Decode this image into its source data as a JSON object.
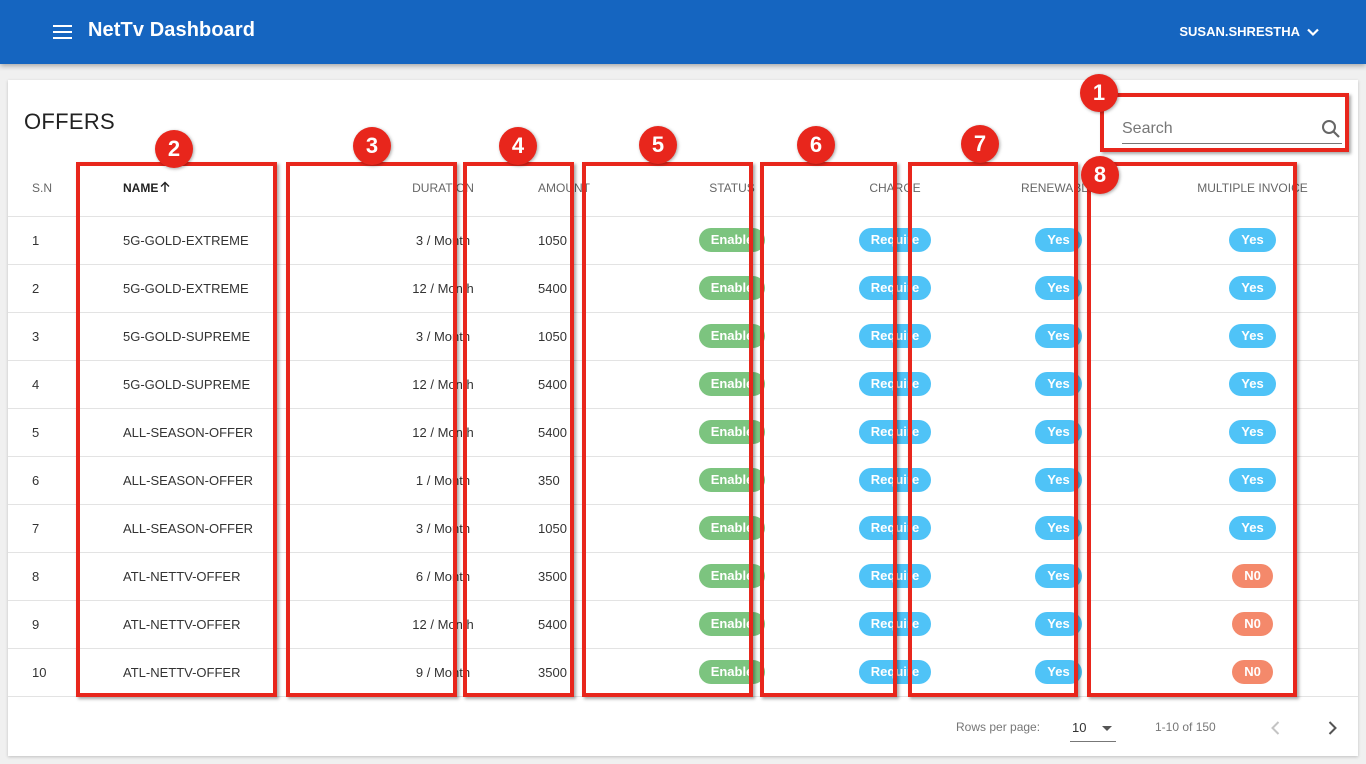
{
  "app": {
    "title": "NetTv Dashboard",
    "user": "SUSAN.SHRESTHA"
  },
  "page": {
    "title": "OFFERS"
  },
  "search": {
    "placeholder": "Search"
  },
  "table": {
    "headers": [
      "S.N",
      "NAME",
      "DURATION",
      "AMOUNT",
      "STATUS",
      "CHARGE",
      "RENEWABLE",
      "MULTIPLE INVOICE"
    ],
    "sort": {
      "column": "NAME",
      "direction": "ascending"
    },
    "rows": [
      [
        "1",
        "5G-GOLD-EXTREME",
        "3 / Month",
        "1050",
        "Enable",
        "Require",
        "Yes",
        "Yes"
      ],
      [
        "2",
        "5G-GOLD-EXTREME",
        "12 / Month",
        "5400",
        "Enable",
        "Require",
        "Yes",
        "Yes"
      ],
      [
        "3",
        "5G-GOLD-SUPREME",
        "3 / Month",
        "1050",
        "Enable",
        "Require",
        "Yes",
        "Yes"
      ],
      [
        "4",
        "5G-GOLD-SUPREME",
        "12 / Month",
        "5400",
        "Enable",
        "Require",
        "Yes",
        "Yes"
      ],
      [
        "5",
        "ALL-SEASON-OFFER",
        "12 / Month",
        "5400",
        "Enable",
        "Require",
        "Yes",
        "Yes"
      ],
      [
        "6",
        "ALL-SEASON-OFFER",
        "1 / Month",
        "350",
        "Enable",
        "Require",
        "Yes",
        "Yes"
      ],
      [
        "7",
        "ALL-SEASON-OFFER",
        "3 / Month",
        "1050",
        "Enable",
        "Require",
        "Yes",
        "Yes"
      ],
      [
        "8",
        "ATL-NETTV-OFFER",
        "6 / Month",
        "3500",
        "Enable",
        "Require",
        "Yes",
        "N0"
      ],
      [
        "9",
        "ATL-NETTV-OFFER",
        "12 / Month",
        "5400",
        "Enable",
        "Require",
        "Yes",
        "N0"
      ],
      [
        "10",
        "ATL-NETTV-OFFER",
        "9 / Month",
        "3500",
        "Enable",
        "Require",
        "Yes",
        "N0"
      ]
    ]
  },
  "pagination": {
    "rows_per_page_label": "Rows per page:",
    "rows_per_page": "10",
    "range": "1-10 of 150"
  },
  "annotations": [
    "1",
    "2",
    "3",
    "4",
    "5",
    "6",
    "7",
    "8"
  ],
  "colors": {
    "appbar": "#1565c0",
    "enable": "#7cc47f",
    "require": "#4fc3f7",
    "yes": "#4fc3f7",
    "no": "#f4896b",
    "annotation": "#e8261c"
  }
}
